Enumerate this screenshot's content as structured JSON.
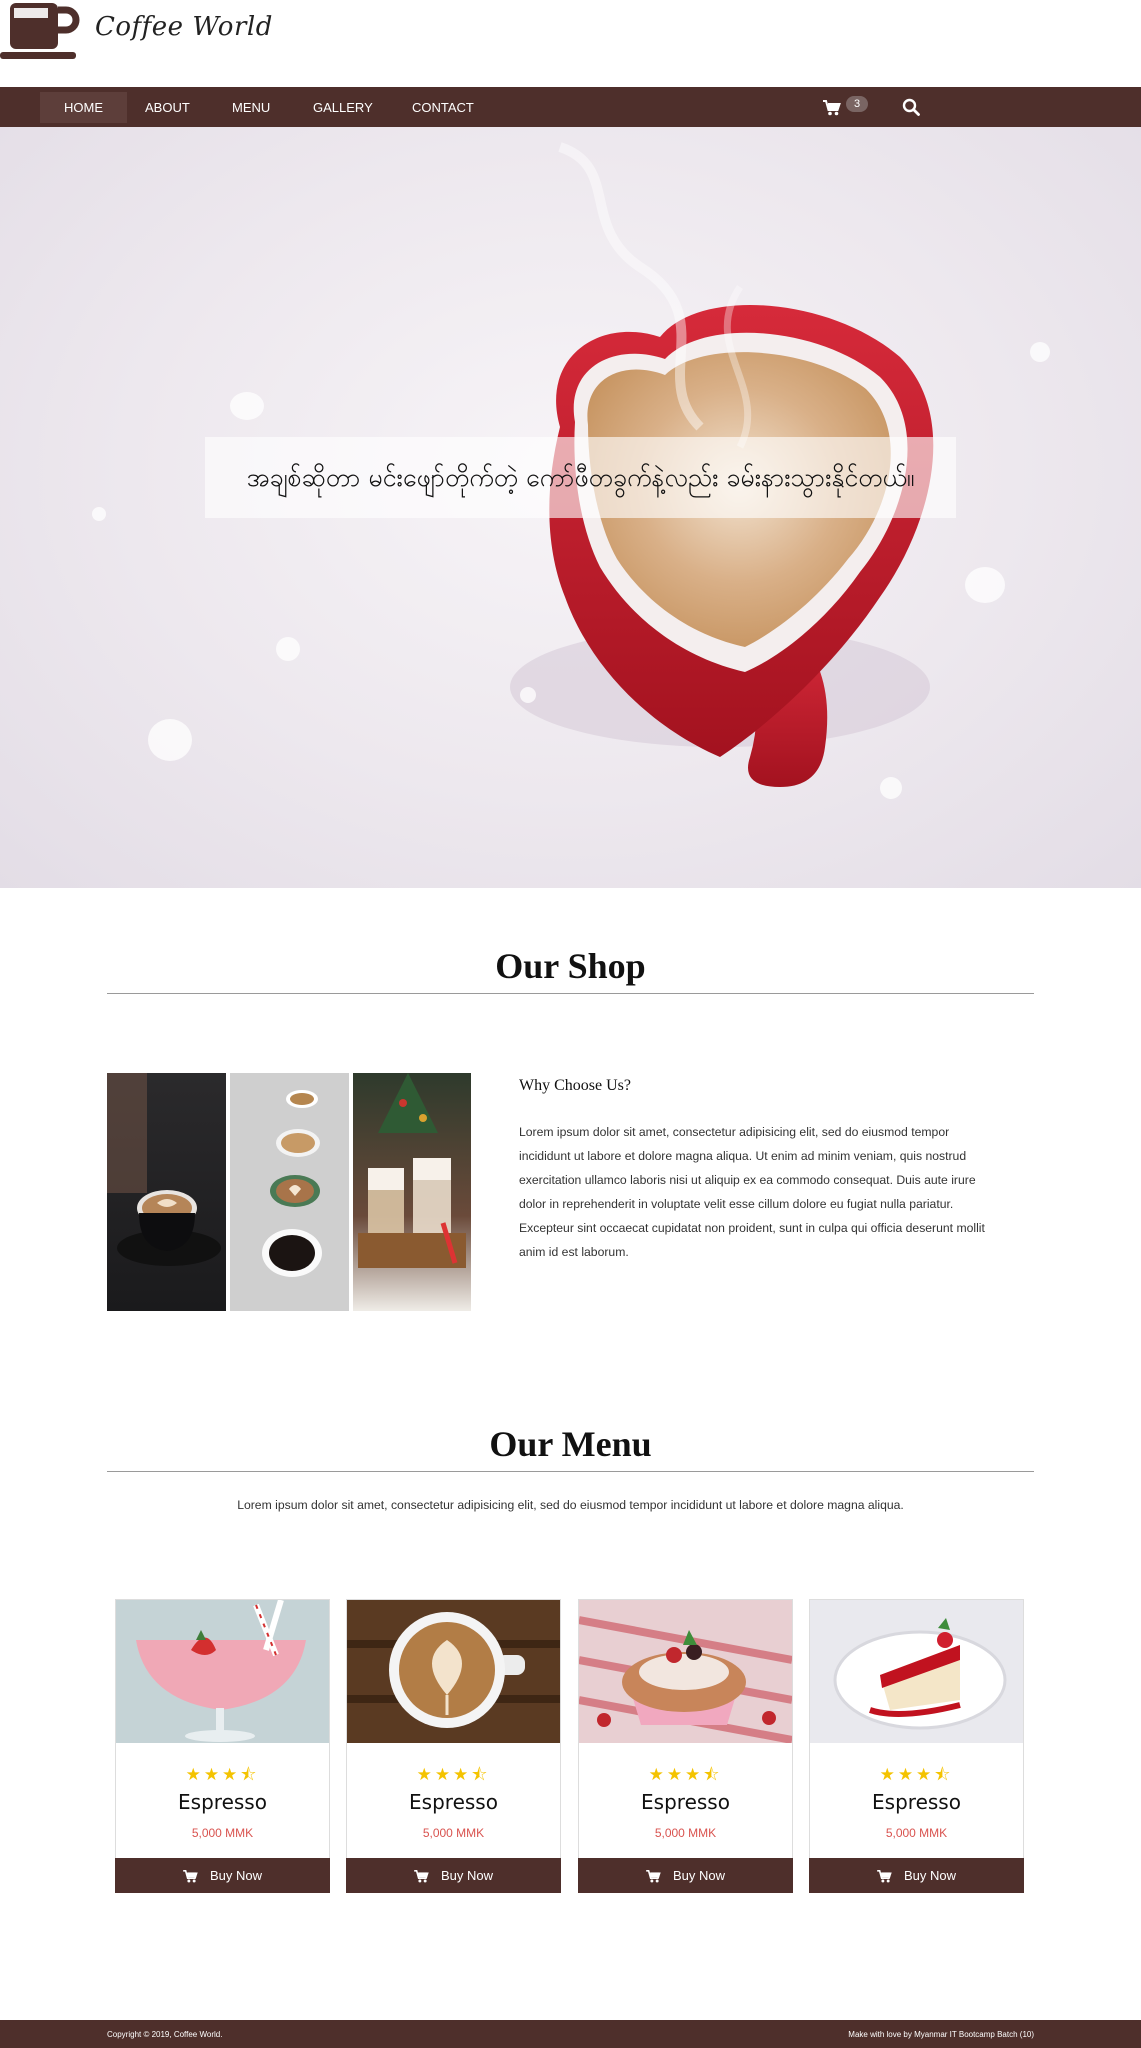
{
  "brand": {
    "name": "Coffee World",
    "logo_icon": "coffee-cup-icon"
  },
  "nav": {
    "items": [
      {
        "label": "HOME",
        "active": true
      },
      {
        "label": "ABOUT"
      },
      {
        "label": "MENU"
      },
      {
        "label": "GALLERY"
      },
      {
        "label": "CONTACT"
      }
    ],
    "cart_count": "3",
    "cart_icon": "cart-icon",
    "search_icon": "search-icon"
  },
  "hero": {
    "banner_text": "အချစ်ဆိုတာ မင်းဖျော်တိုက်တဲ့ ကော်ဖီတခွက်နဲ့လည်း ခမ်းနားသွားနိုင်တယ်။"
  },
  "shop": {
    "title": "Our Shop",
    "subtitle": "Why Choose Us?",
    "paragraph": "Lorem ipsum dolor sit amet, consectetur adipisicing elit, sed do eiusmod tempor incididunt ut labore et dolore magna aliqua. Ut enim ad minim veniam, quis nostrud exercitation ullamco laboris nisi ut aliquip ex ea commodo consequat. Duis aute irure dolor in reprehenderit in voluptate velit esse cillum dolore eu fugiat nulla pariatur. Excepteur sint occaecat cupidatat non proident, sunt in culpa qui officia deserunt mollit anim id est laborum."
  },
  "menu": {
    "title": "Our Menu",
    "intro": "Lorem ipsum dolor sit amet, consectetur adipisicing elit, sed do eiusmod tempor incididunt ut labore et dolore magna aliqua.",
    "items": [
      {
        "name": "Espresso",
        "price": "5,000 MMK",
        "rating": 3.5,
        "button": "Buy Now"
      },
      {
        "name": "Espresso",
        "price": "5,000 MMK",
        "rating": 3.5,
        "button": "Buy Now"
      },
      {
        "name": "Espresso",
        "price": "5,000 MMK",
        "rating": 3.5,
        "button": "Buy Now"
      },
      {
        "name": "Espresso",
        "price": "5,000 MMK",
        "rating": 3.5,
        "button": "Buy Now"
      }
    ]
  },
  "footer": {
    "copyright": "Copyright © 2019, Coffee World.",
    "credit": "Make with love by Myanmar IT Bootcamp Batch (10)"
  },
  "colors": {
    "brand_brown": "#4e2f2b",
    "price_red": "#d9534f",
    "star_yellow": "#f4c300"
  }
}
